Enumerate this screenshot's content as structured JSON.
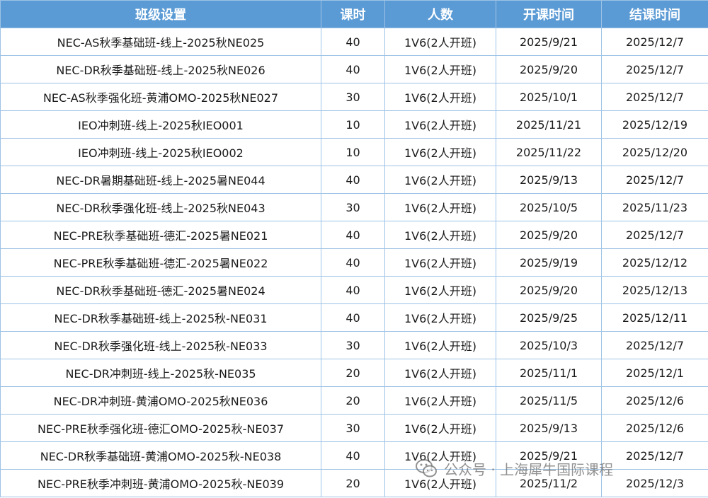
{
  "headers": [
    "班级设置",
    "课时",
    "人数",
    "开课时间",
    "结课时间"
  ],
  "rows": [
    [
      "NEC-AS秋季基础班-线上-2025秋NE025",
      "40",
      "1V6(2人开班)",
      "2025/9/21",
      "2025/12/7"
    ],
    [
      "NEC-DR秋季基础班-线上-2025秋NE026",
      "40",
      "1V6(2人开班)",
      "2025/9/20",
      "2025/12/7"
    ],
    [
      "NEC-AS秋季强化班-黄浦OMO-2025秋NE027",
      "30",
      "1V6(2人开班)",
      "2025/10/1",
      "2025/12/7"
    ],
    [
      "IEO冲刺班-线上-2025秋IEO001",
      "10",
      "1V6(2人开班)",
      "2025/11/21",
      "2025/12/19"
    ],
    [
      "IEO冲刺班-线上-2025秋IEO002",
      "10",
      "1V6(2人开班)",
      "2025/11/22",
      "2025/12/20"
    ],
    [
      "NEC-DR暑期基础班-线上-2025暑NE044",
      "40",
      "1V6(2人开班)",
      "2025/9/13",
      "2025/12/7"
    ],
    [
      "NEC-DR秋季强化班-线上-2025秋NE043",
      "30",
      "1V6(2人开班)",
      "2025/10/5",
      "2025/11/23"
    ],
    [
      "NEC-PRE秋季基础班-德汇-2025暑NE021",
      "40",
      "1V6(2人开班)",
      "2025/9/20",
      "2025/12/7"
    ],
    [
      "NEC-PRE秋季基础班-德汇-2025暑NE022",
      "40",
      "1V6(2人开班)",
      "2025/9/19",
      "2025/12/12"
    ],
    [
      "NEC-DR秋季基础班-德汇-2025暑NE024",
      "40",
      "1V6(2人开班)",
      "2025/9/20",
      "2025/12/13"
    ],
    [
      "NEC-DR秋季基础班-线上-2025秋-NE031",
      "40",
      "1V6(2人开班)",
      "2025/9/25",
      "2025/12/11"
    ],
    [
      "NEC-DR秋季强化班-线上-2025秋-NE033",
      "30",
      "1V6(2人开班)",
      "2025/10/3",
      "2025/12/7"
    ],
    [
      "NEC-DR冲刺班-线上-2025秋-NE035",
      "20",
      "1V6(2人开班)",
      "2025/11/1",
      "2025/12/1"
    ],
    [
      "NEC-DR冲刺班-黄浦OMO-2025秋NE036",
      "20",
      "1V6(2人开班)",
      "2025/11/5",
      "2025/12/6"
    ],
    [
      "NEC-PRE秋季强化班-德汇OMO-2025秋-NE037",
      "30",
      "1V6(2人开班)",
      "2025/9/13",
      "2025/12/6"
    ],
    [
      "NEC-DR秋季基础班-黄浦OMO-2025秋-NE038",
      "40",
      "1V6(2人开班)",
      "2025/9/21",
      "2025/12/7"
    ],
    [
      "NEC-PRE秋季冲刺班-黄浦OMO-2025秋-NE039",
      "20",
      "1V6(2人开班)",
      "2025/11/2",
      "2025/12/3"
    ]
  ],
  "watermark": {
    "text": "公众号 · 上海犀牛国际课程",
    "icon": "wechat-icon"
  },
  "colors": {
    "header_bg": "#5b9bd5",
    "header_text": "#ffffff",
    "border": "#9dc3e6"
  }
}
